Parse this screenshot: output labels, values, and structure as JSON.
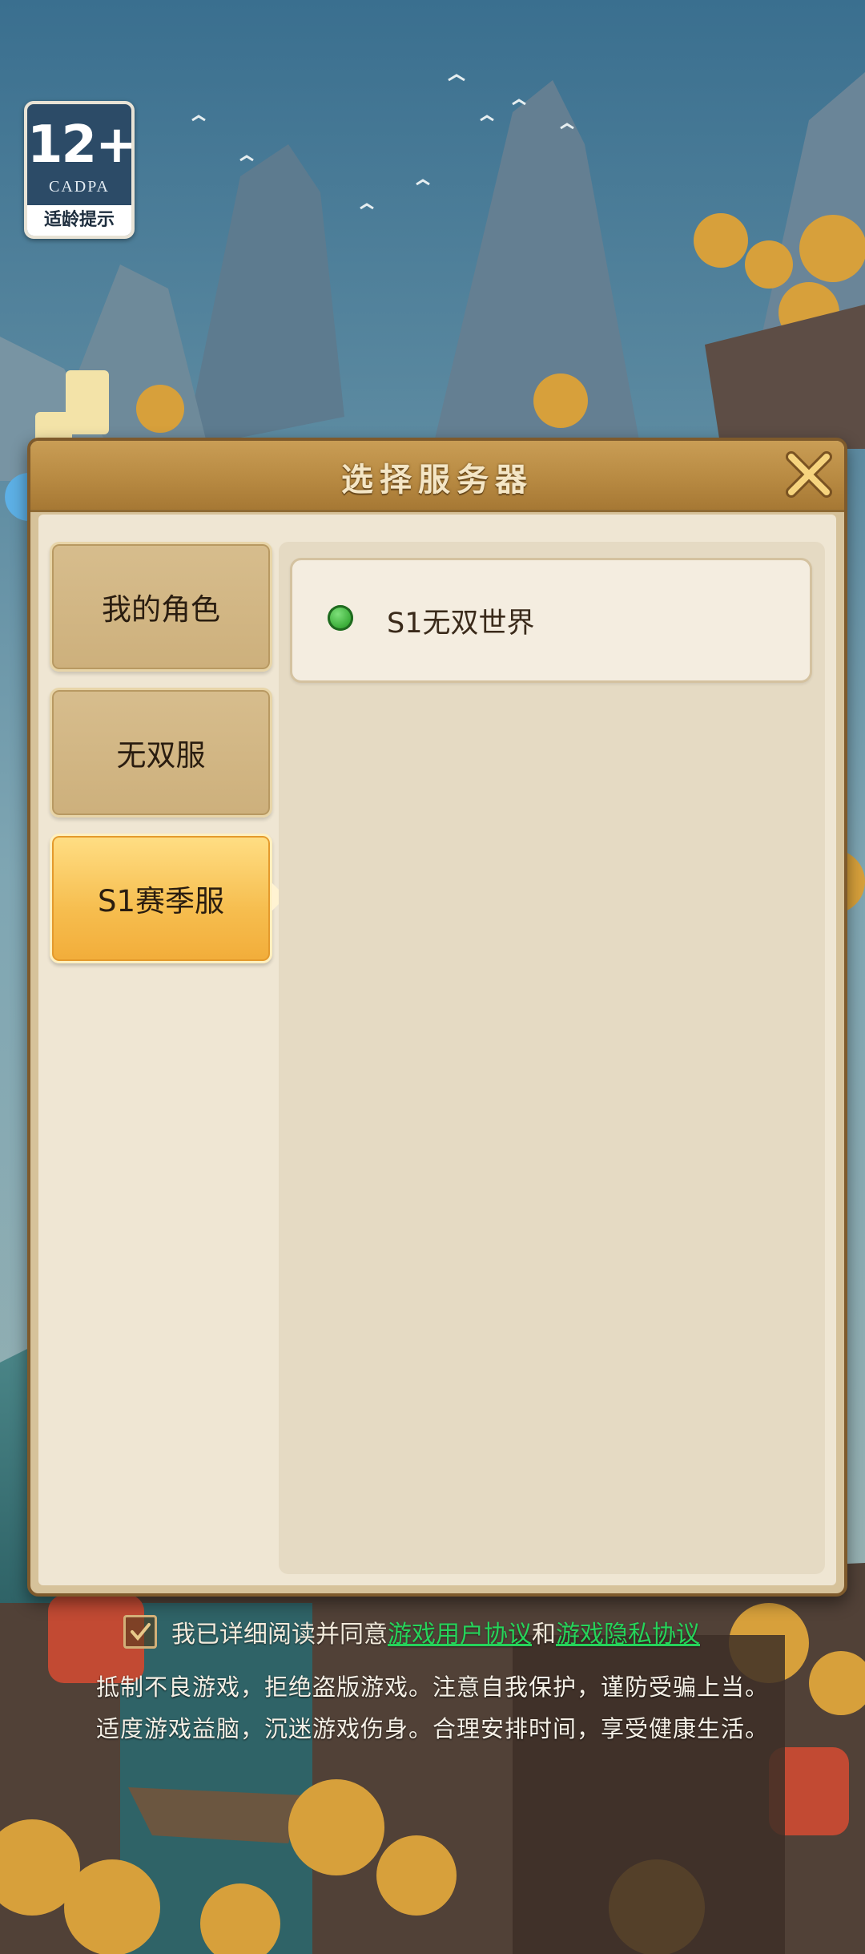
{
  "age_badge": {
    "age": "12+",
    "org": "CADPA",
    "tip": "适龄提示"
  },
  "dialog": {
    "title": "选择服务器",
    "tabs": [
      {
        "label": "我的角色",
        "active": false
      },
      {
        "label": "无双服",
        "active": false
      },
      {
        "label": "S1赛季服",
        "active": true
      }
    ],
    "servers": [
      {
        "name": "S1无双世界",
        "status": "online",
        "status_color": "#3cae3a"
      }
    ]
  },
  "footer": {
    "agree_checked": true,
    "agree_prefix": "我已详细阅读并同意",
    "user_agreement": "游戏用户协议",
    "and_text": "和",
    "privacy_agreement": "游戏隐私协议",
    "notice_line1": "抵制不良游戏，拒绝盗版游戏。注意自我保护，谨防受骗上当。",
    "notice_line2": "适度游戏益脑，沉迷游戏伤身。合理安排时间，享受健康生活。"
  },
  "colors": {
    "accent": "#f6bd4e",
    "link": "#26d35a",
    "frame": "#7e5a2c"
  }
}
